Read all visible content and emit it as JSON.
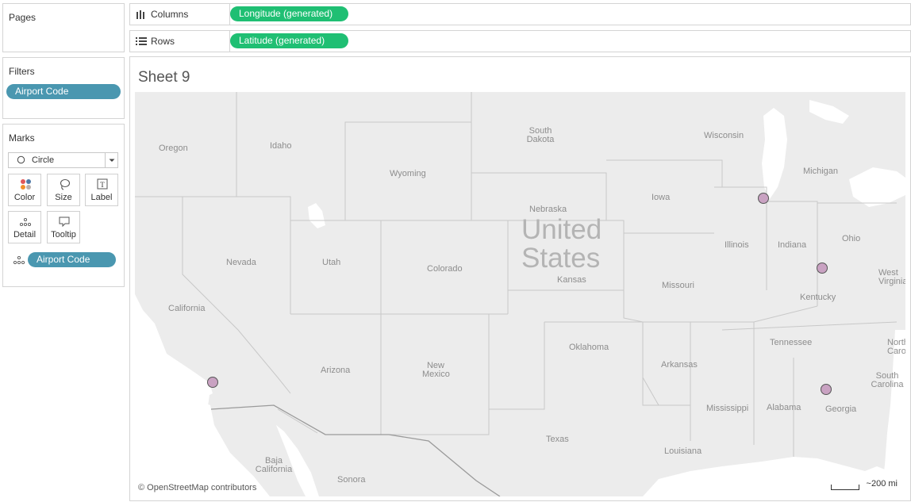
{
  "left_panel": {
    "pages_title": "Pages",
    "filters_title": "Filters",
    "filters": [
      "Airport Code"
    ],
    "marks_title": "Marks",
    "mark_type": "Circle",
    "mark_buttons": [
      {
        "label": "Color",
        "icon": "color-dots-icon"
      },
      {
        "label": "Size",
        "icon": "size-lasso-icon"
      },
      {
        "label": "Label",
        "icon": "label-t-icon"
      },
      {
        "label": "Detail",
        "icon": "detail-dots-icon"
      },
      {
        "label": "Tooltip",
        "icon": "tooltip-bubble-icon"
      }
    ],
    "mark_field": "Airport Code"
  },
  "shelves": {
    "columns_label": "Columns",
    "columns_pill": "Longitude (generated)",
    "rows_label": "Rows",
    "rows_pill": "Latitude (generated)"
  },
  "sheet": {
    "title": "Sheet 9",
    "country_label_1": "United",
    "country_label_2": "States",
    "states": [
      "Oregon",
      "Idaho",
      "South Dakota",
      "Wisconsin",
      "Michigan",
      "Wyoming",
      "Iowa",
      "Nebraska",
      "Nevada",
      "Utah",
      "Colorado",
      "Kansas",
      "Illinois",
      "Indiana",
      "Ohio",
      "West Virginia",
      "California",
      "Missouri",
      "Kentucky",
      "Oklahoma",
      "Tennessee",
      "North Carolina",
      "Arizona",
      "New Mexico",
      "Arkansas",
      "South Carolina",
      "Mississippi",
      "Alabama",
      "Georgia",
      "Texas",
      "Louisiana",
      "Baja California",
      "Sonora"
    ],
    "attribution": "© OpenStreetMap contributors",
    "scale": "~200 mi",
    "mark_count": 4
  },
  "colors": {
    "pill_green": "#1fbf73",
    "pill_blue": "#4a97b0",
    "mark_fill": "#c9a2c2",
    "map_land": "#ececec",
    "map_water": "#ffffff"
  }
}
